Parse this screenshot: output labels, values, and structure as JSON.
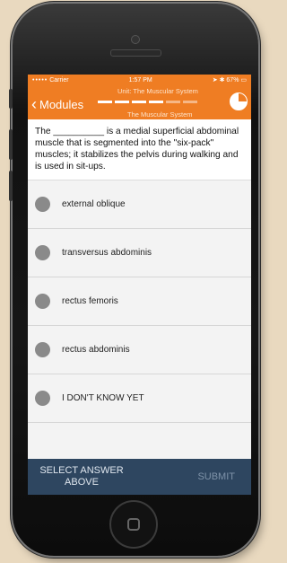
{
  "status_bar": {
    "carrier": "Carrier",
    "time": "1:57 PM",
    "battery": "67%"
  },
  "nav": {
    "back_label": "Modules",
    "unit_title": "Unit: The Muscular System",
    "subtitle": "The Muscular System",
    "progress_segments": 6,
    "progress_completed": 4,
    "accent_color": "#ef7d23"
  },
  "question": {
    "text": "The __________ is a medial superficial abdominal muscle that is segmented into the \"six-pack\" muscles; it stabilizes the pelvis during walking and is used in sit-ups."
  },
  "answers": [
    {
      "label": "external oblique"
    },
    {
      "label": "transversus abdominis"
    },
    {
      "label": "rectus femoris"
    },
    {
      "label": "rectus abdominis"
    },
    {
      "label": "I DON'T KNOW YET"
    }
  ],
  "footer": {
    "select_message": "SELECT ANSWER ABOVE",
    "submit_label": "SUBMIT",
    "bar_color": "#2e4660"
  }
}
